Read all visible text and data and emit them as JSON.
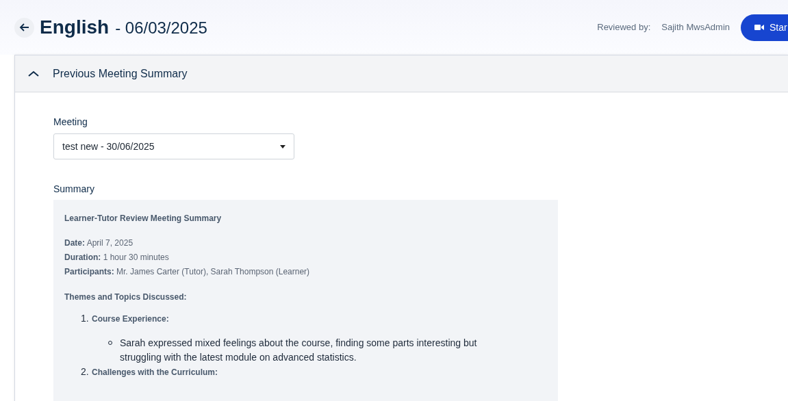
{
  "page": {
    "title": "English",
    "date": "- 06/03/2025"
  },
  "reviewed_by": {
    "label": "Reviewed by:",
    "name": "Sajith MwsAdmin"
  },
  "start_button": {
    "label": "Star"
  },
  "panel": {
    "title": "Previous Meeting Summary",
    "expanded": true
  },
  "meeting": {
    "label": "Meeting",
    "value": "test new - 30/06/2025"
  },
  "summary": {
    "label": "Summary",
    "heading": "Learner-Tutor Review Meeting Summary",
    "details": [
      "**Date:** April 7, 2025",
      "**Duration:** 1 hour 30 minutes",
      "**Participants:** Mr. James Carter (Tutor), Sarah Thompson (Learner)"
    ],
    "themes_heading": "Themes and Topics Discussed:",
    "themes": [
      {
        "number": "1.",
        "title": "Course Experience:",
        "points": [
          "Sarah expressed mixed feelings about the course, finding some parts interesting but struggling with the latest module on advanced statistics."
        ]
      },
      {
        "number": "2.",
        "title": "Challenges with the Curriculum:"
      }
    ]
  }
}
